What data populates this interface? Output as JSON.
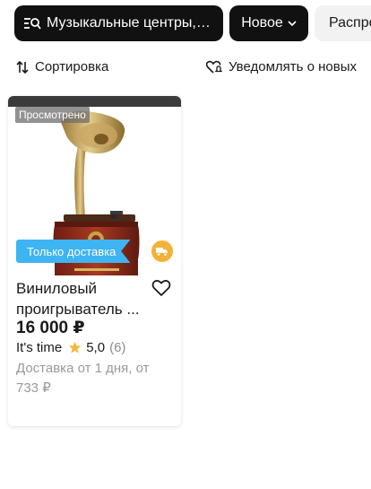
{
  "chips": {
    "search": "Музыкальные центры, м...",
    "sort": "Новое",
    "distribution": "Распро"
  },
  "toolbar": {
    "sort_label": "Сортировка",
    "notify_label": "Уведомлять о новых"
  },
  "product": {
    "seen_badge": "Просмотрено",
    "delivery_badge": "Только доставка",
    "title_line1": "Виниловый",
    "title_line2": "проигрыватель ...",
    "price": "16 000 ₽",
    "seller": "It's time",
    "rating": "5,0",
    "reviews": "(6)",
    "delivery_line1": "Доставка от 1 дня, от",
    "delivery_line2": "733 ₽"
  },
  "icons": {
    "search": "search-list-icon",
    "chevron": "chevron-down-icon",
    "sort": "sort-arrows-icon",
    "notify": "heart-bell-icon",
    "favorite": "heart-icon",
    "star": "star-icon",
    "truck": "truck-icon"
  },
  "colors": {
    "chip_dark": "#111111",
    "chip_light": "#f2f2f2",
    "delivery_badge": "#3fb4f2",
    "truck_badge": "#f4b13a",
    "star": "#f6b93b",
    "muted": "#9a9a9a"
  }
}
